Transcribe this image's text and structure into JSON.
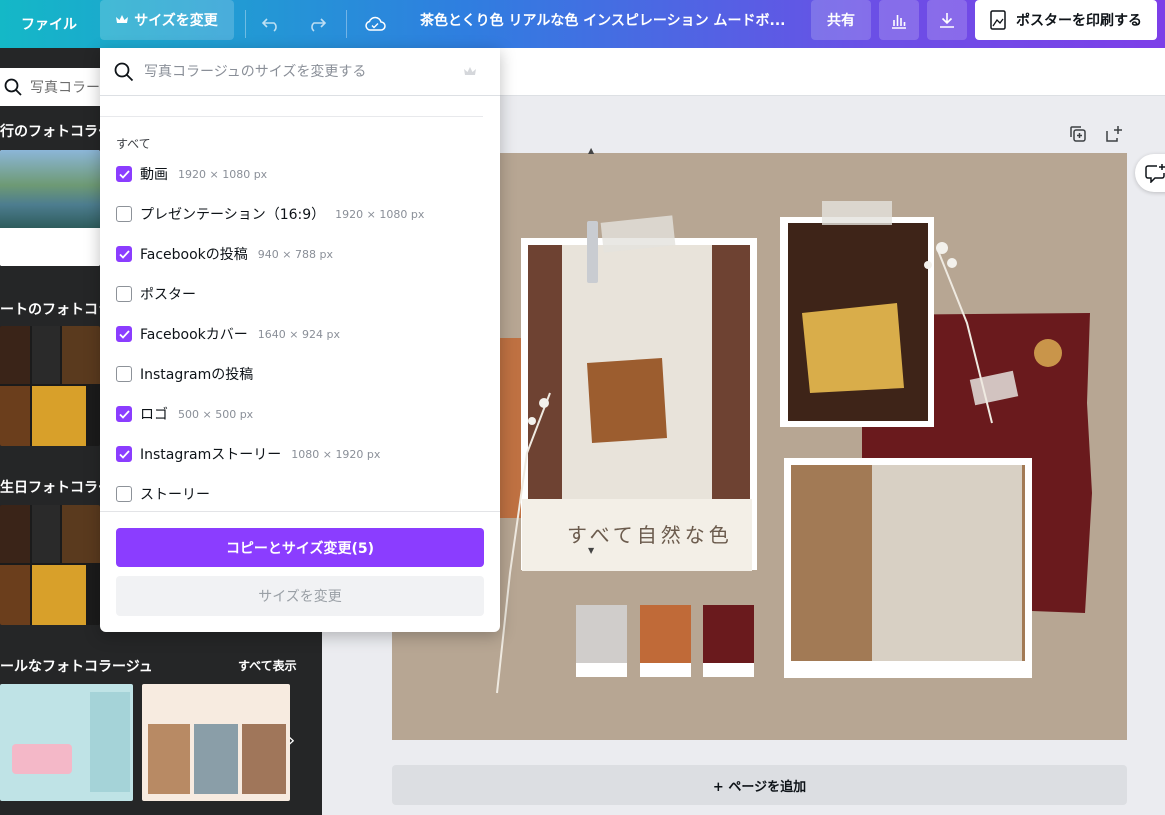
{
  "topbar": {
    "file_label": "ファイル",
    "resize_label": "サイズを変更",
    "title": "茶色とくり色 リアルな色 インスピレーション ムードボ...",
    "share_label": "共有",
    "print_label": "ポスターを印刷する"
  },
  "left_panel": {
    "search_placeholder": "写真コラージ",
    "section1_title": "行のフォトコラー",
    "section2_title": "ートのフォトコラ",
    "section3_title": "生日フォトコラー",
    "section4_title": "ールなフォトコラージュ",
    "see_all": "すべて表示"
  },
  "dropdown": {
    "search_placeholder": "写真コラージュのサイズを変更する",
    "section_label": "すべて",
    "items": [
      {
        "label": "動画",
        "size": "1920 × 1080 px",
        "checked": true
      },
      {
        "label": "プレゼンテーション（16:9）",
        "size": "1920 × 1080 px",
        "checked": false
      },
      {
        "label": "Facebookの投稿",
        "size": "940 × 788 px",
        "checked": true
      },
      {
        "label": "ポスター",
        "size": "",
        "checked": false
      },
      {
        "label": "Facebookカバー",
        "size": "1640 × 924 px",
        "checked": true
      },
      {
        "label": "Instagramの投稿",
        "size": "",
        "checked": false
      },
      {
        "label": "ロゴ",
        "size": "500 × 500 px",
        "checked": true
      },
      {
        "label": "Instagramストーリー",
        "size": "1080 × 1920 px",
        "checked": true
      },
      {
        "label": "ストーリー",
        "size": "",
        "checked": false
      }
    ],
    "copy_resize_label": "コピーとサイズ変更(5)",
    "resize_label": "サイズを変更"
  },
  "canvas": {
    "caption": "すべて自然な色",
    "swatch_colors": [
      "#d0cdcb",
      "#c06a38",
      "#6a1a1d"
    ]
  },
  "add_page_label": "+ ページを追加",
  "colors": {
    "accent": "#8b3dff",
    "canvas_bg": "#b7a693",
    "maroon": "#6a1a1d"
  }
}
